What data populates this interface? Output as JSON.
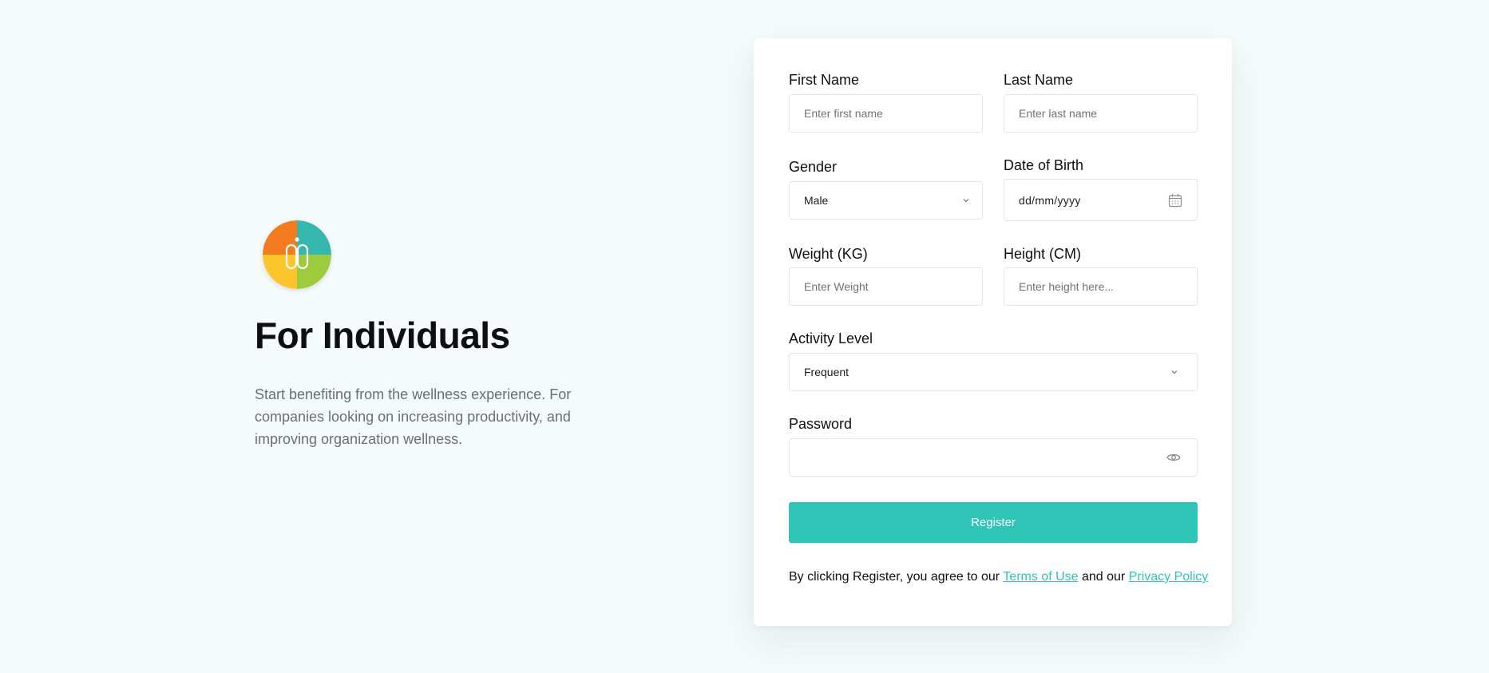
{
  "hero": {
    "logo_icon": "wellness-logo-icon",
    "title": "For Individuals",
    "description": "Start benefiting from the wellness experience. For companies looking on increasing productivity, and improving organization wellness."
  },
  "form": {
    "first_name": {
      "label": "First Name",
      "placeholder": "Enter first name",
      "value": ""
    },
    "last_name": {
      "label": "Last Name",
      "placeholder": "Enter last name",
      "value": ""
    },
    "gender": {
      "label": "Gender",
      "selected": "Male",
      "icon": "chevron-down-icon"
    },
    "dob": {
      "label": "Date of Birth",
      "placeholder": "dd/mm/yyyy",
      "icon": "calendar-icon"
    },
    "weight": {
      "label": "Weight (KG)",
      "placeholder": "Enter Weight",
      "value": ""
    },
    "height": {
      "label": "Height (CM)",
      "placeholder": "Enter height here...",
      "value": ""
    },
    "activity": {
      "label": "Activity Level",
      "selected": "Frequent",
      "icon": "chevron-down-icon"
    },
    "password": {
      "label": "Password",
      "value": "",
      "icon": "eye-icon"
    },
    "register_label": "Register",
    "terms": {
      "prefix": "By clicking Register, you agree to our ",
      "terms_link": "Terms of Use",
      "middle": " and our ",
      "privacy_link": "Privacy Policy"
    }
  },
  "colors": {
    "background": "#f5fafa",
    "accent": "#2ec4b6",
    "logo_orange": "#f47b20",
    "logo_teal": "#35b7ad",
    "logo_yellow": "#fcc52b",
    "logo_green": "#9ccb3b"
  }
}
